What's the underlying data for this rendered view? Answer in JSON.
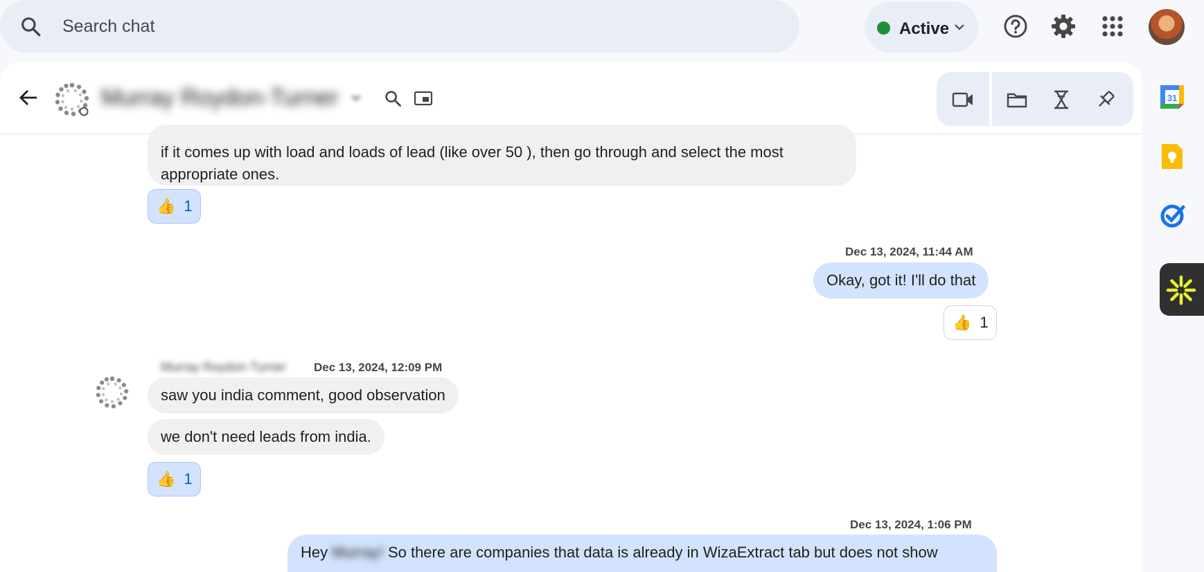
{
  "topbar": {
    "search_placeholder": "Search chat",
    "status_label": "Active",
    "status_color": "#1e8e3e",
    "icons": [
      "search-icon",
      "help-icon",
      "settings-icon",
      "apps-grid-icon",
      "account-avatar"
    ]
  },
  "chat_header": {
    "title": "Murray Roydon-Turner",
    "icons": [
      "back-arrow-icon",
      "space-icon",
      "search-icon",
      "picture-in-picture-icon",
      "video-call-icon",
      "folder-icon",
      "hourglass-icon",
      "pin-icon"
    ]
  },
  "messages": {
    "m1": {
      "text_line1": "if it comes up with load and loads of lead (like over 50 ), then go through and select the most",
      "text_line2": "appropriate ones.",
      "reaction_emoji": "👍",
      "reaction_count": "1"
    },
    "m2": {
      "timestamp": "Dec 13, 2024, 11:44 AM",
      "text": "Okay, got it! I'll do that",
      "reaction_emoji": "👍",
      "reaction_count": "1"
    },
    "m3": {
      "sender": "Murray Roydon-Turner",
      "timestamp": "Dec 13, 2024, 12:09 PM",
      "text1": "saw you india comment, good observation",
      "text2": "we don't need leads from india.",
      "reaction_emoji": "👍",
      "reaction_count": "1"
    },
    "m4": {
      "timestamp": "Dec 13, 2024, 1:06 PM",
      "text_prefix": "Hey",
      "text_name": "Murray!",
      "text_rest": "So there are companies that data is already in WizaExtract tab but does not show"
    }
  },
  "rail": {
    "icons": [
      "calendar-icon",
      "keep-icon",
      "tasks-icon",
      "addon-icon"
    ],
    "calendar_day": "31"
  }
}
